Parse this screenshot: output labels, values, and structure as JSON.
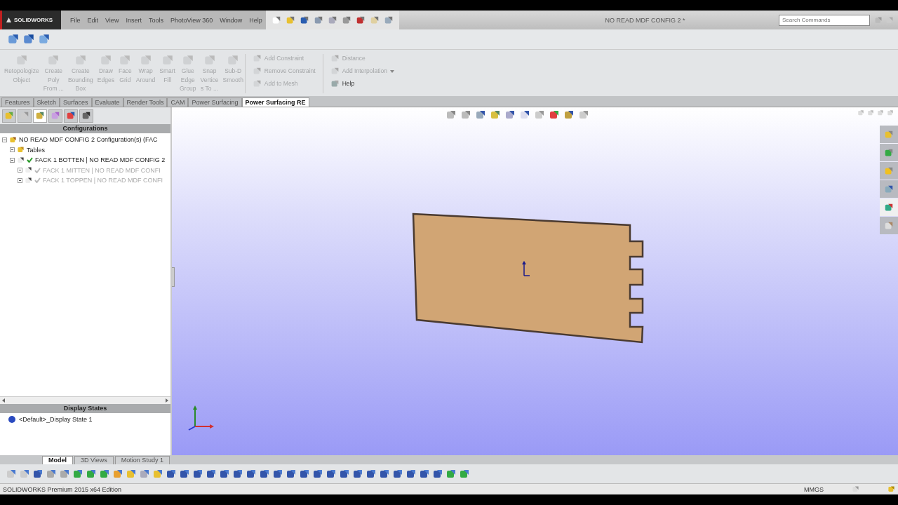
{
  "title_bar": {
    "logo": "SOLIDWORKS",
    "menu": [
      "File",
      "Edit",
      "View",
      "Insert",
      "Tools",
      "PhotoView 360",
      "Window",
      "Help"
    ],
    "document_title": "NO READ  MDF CONFIG 2 *",
    "search": {
      "placeholder": "Search Commands"
    }
  },
  "ribbon": {
    "large_items": [
      {
        "label": "Retopologize\nObject",
        "disabled": true
      },
      {
        "label": "Create\nPoly\nFrom ...",
        "disabled": true
      },
      {
        "label": "Create\nBounding\nBox",
        "disabled": true
      },
      {
        "label": "Draw\nEdges",
        "disabled": true
      },
      {
        "label": "Face\nGrid",
        "disabled": true
      },
      {
        "label": "Wrap\nAround",
        "disabled": true
      },
      {
        "label": "Smart\nFill",
        "disabled": true
      },
      {
        "label": "Glue\nEdge\nGroup",
        "disabled": true
      },
      {
        "label": "Snap\nVertice\ns To ...",
        "disabled": true
      },
      {
        "label": "Sub-D\nSmooth",
        "disabled": true
      }
    ],
    "small_groups": [
      [
        {
          "label": "Add Constraint",
          "disabled": true,
          "dropdown": false
        },
        {
          "label": "Remove Constraint",
          "disabled": true,
          "dropdown": false
        },
        {
          "label": "Add to Mesh",
          "disabled": true,
          "dropdown": false
        }
      ],
      [
        {
          "label": "Distance",
          "disabled": true,
          "dropdown": false
        },
        {
          "label": "Add Interpolation",
          "disabled": true,
          "dropdown": true
        },
        {
          "label": "Help",
          "disabled": false,
          "dropdown": false
        }
      ]
    ]
  },
  "command_tabs": [
    {
      "label": "Features",
      "selected": false
    },
    {
      "label": "Sketch",
      "selected": false
    },
    {
      "label": "Surfaces",
      "selected": false
    },
    {
      "label": "Evaluate",
      "selected": false
    },
    {
      "label": "Render Tools",
      "selected": false
    },
    {
      "label": "CAM",
      "selected": false
    },
    {
      "label": "Power Surfacing",
      "selected": false
    },
    {
      "label": "Power Surfacing RE",
      "selected": true
    }
  ],
  "panel_tabs": [
    {
      "selected": false
    },
    {
      "selected": false
    },
    {
      "selected": true
    },
    {
      "selected": false
    },
    {
      "selected": false
    },
    {
      "selected": false
    }
  ],
  "configurations": {
    "title": "Configurations",
    "tree": [
      {
        "label": "NO READ  MDF CONFIG 2 Configuration(s)  (FAC",
        "kind": "root",
        "active": true,
        "children": [
          {
            "label": "Tables",
            "kind": "folder",
            "active": true
          },
          {
            "label": "FACK 1 BOTTEN | NO READ  MDF CONFIG 2",
            "kind": "config",
            "active": true,
            "children": [
              {
                "label": "FACK 1 MITTEN | NO READ  MDF CONFI",
                "kind": "config",
                "active": false
              },
              {
                "label": "FACK 1 TOPPEN | NO READ  MDF CONFI",
                "kind": "config",
                "active": false
              }
            ]
          }
        ]
      }
    ]
  },
  "task_pane": [
    {
      "selected": false
    },
    {
      "selected": false
    },
    {
      "selected": false
    },
    {
      "selected": false
    },
    {
      "selected": true
    },
    {
      "selected": false
    }
  ],
  "display_states": {
    "title": "Display States",
    "items": [
      "<Default>_Display State 1"
    ]
  },
  "bottom_tabs": [
    {
      "label": "Model",
      "selected": true
    },
    {
      "label": "3D Views",
      "selected": false
    },
    {
      "label": "Motion Study 1",
      "selected": false
    }
  ],
  "status_bar": {
    "edition": "SOLIDWORKS Premium 2015 x64 Edition",
    "units": "MMGS"
  }
}
